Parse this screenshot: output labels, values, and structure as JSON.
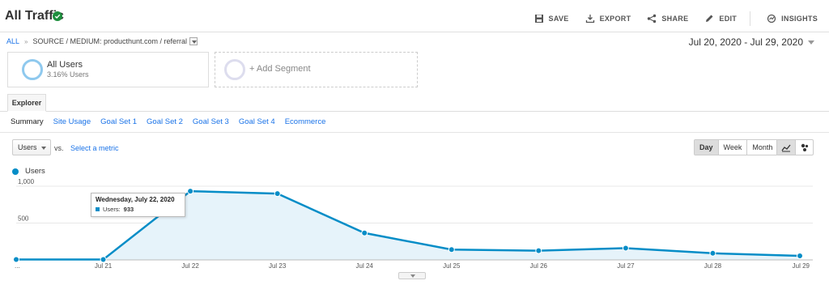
{
  "header": {
    "title": "All Traffic",
    "actions": [
      {
        "label": "SAVE",
        "icon": "save-icon"
      },
      {
        "label": "EXPORT",
        "icon": "export-icon"
      },
      {
        "label": "SHARE",
        "icon": "share-icon"
      },
      {
        "label": "EDIT",
        "icon": "edit-icon"
      },
      {
        "label": "INSIGHTS",
        "icon": "insights-icon"
      }
    ]
  },
  "breadcrumb": {
    "root": "ALL",
    "path": "SOURCE / MEDIUM: producthunt.com / referral"
  },
  "date_range": "Jul 20, 2020 - Jul 29, 2020",
  "segments": {
    "active": {
      "name": "All Users",
      "sub": "3.16% Users"
    },
    "add": "+ Add Segment"
  },
  "explorer_tab": "Explorer",
  "subtabs": [
    "Summary",
    "Site Usage",
    "Goal Set 1",
    "Goal Set 2",
    "Goal Set 3",
    "Goal Set 4",
    "Ecommerce"
  ],
  "controls": {
    "metric": "Users",
    "vs": "vs.",
    "select_metric": "Select a metric",
    "periods": [
      "Day",
      "Week",
      "Month"
    ],
    "active_period": "Day"
  },
  "tooltip": {
    "date": "Wednesday, July 22, 2020",
    "label": "Users:",
    "value": "933"
  },
  "colors": {
    "series": "#058dc7",
    "fill": "#e6f3fa",
    "link": "#1a73e8"
  },
  "chart_data": {
    "type": "area",
    "x": [
      "Jul 20",
      "Jul 21",
      "Jul 22",
      "Jul 23",
      "Jul 24",
      "Jul 25",
      "Jul 26",
      "Jul 27",
      "Jul 28",
      "Jul 29"
    ],
    "x_tick_labels": [
      "...",
      "Jul 21",
      "Jul 22",
      "Jul 23",
      "Jul 24",
      "Jul 25",
      "Jul 26",
      "Jul 27",
      "Jul 28",
      "Jul 29"
    ],
    "series": [
      {
        "name": "Users",
        "values": [
          5,
          5,
          933,
          900,
          365,
          140,
          125,
          160,
          90,
          55
        ]
      }
    ],
    "y_ticks": [
      {
        "value": 500,
        "label": "500"
      },
      {
        "value": 1000,
        "label": "1,000"
      }
    ],
    "ylim": [
      0,
      1000
    ],
    "grid": true,
    "legend": "top-left"
  }
}
